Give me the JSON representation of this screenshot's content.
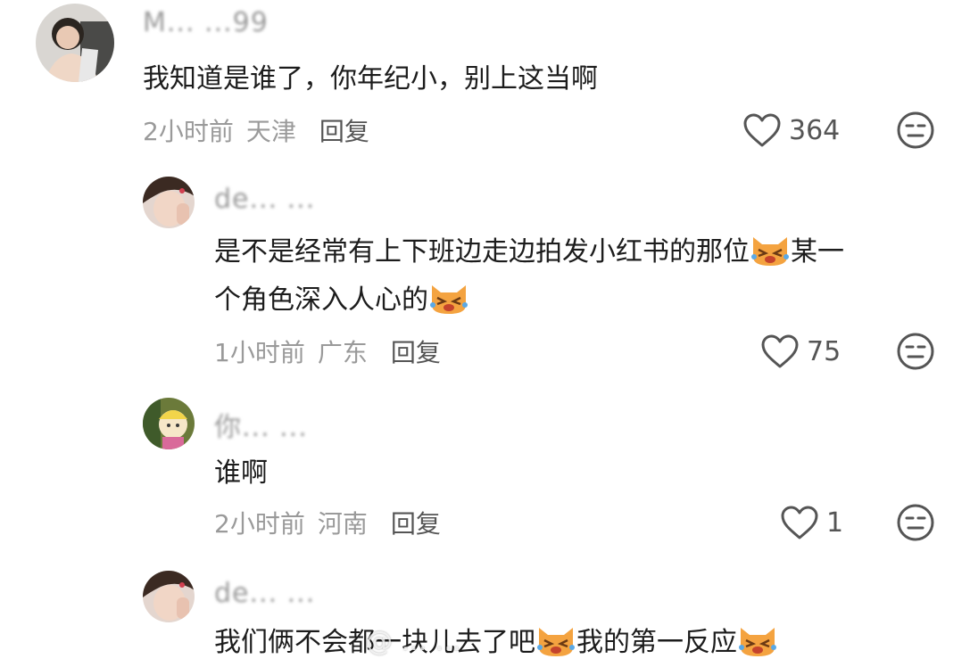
{
  "comments": [
    {
      "username": "M... ...99",
      "text": "我知道是谁了，你年纪小，别上这当啊",
      "time": "2小时前",
      "location": "天津",
      "reply_label": "回复",
      "likes": "364"
    },
    {
      "username": "de... ...",
      "text_line1": "是不是经常有上下班边走边拍发小红书的那位",
      "text_line1_tail": "某一",
      "text_line2": "个角色深入人心的",
      "time": "1小时前",
      "location": "广东",
      "reply_label": "回复",
      "likes": "75"
    },
    {
      "username": "你... ...",
      "text": "谁啊",
      "time": "2小时前",
      "location": "河南",
      "reply_label": "回复",
      "likes": "1"
    },
    {
      "username": "de... ...",
      "text_part1": "我们俩不会都",
      "text_part2": "一块儿去了吧",
      "text_part3": "我的第一反应"
    }
  ],
  "watermark": "@ ... ...",
  "colors": {
    "meta": "#9a9a9a",
    "reply": "#555555",
    "emoji": "#f4a340"
  },
  "icons": [
    "heart-outline-icon",
    "neutral-face-icon",
    "laughing-cat-emoji"
  ]
}
